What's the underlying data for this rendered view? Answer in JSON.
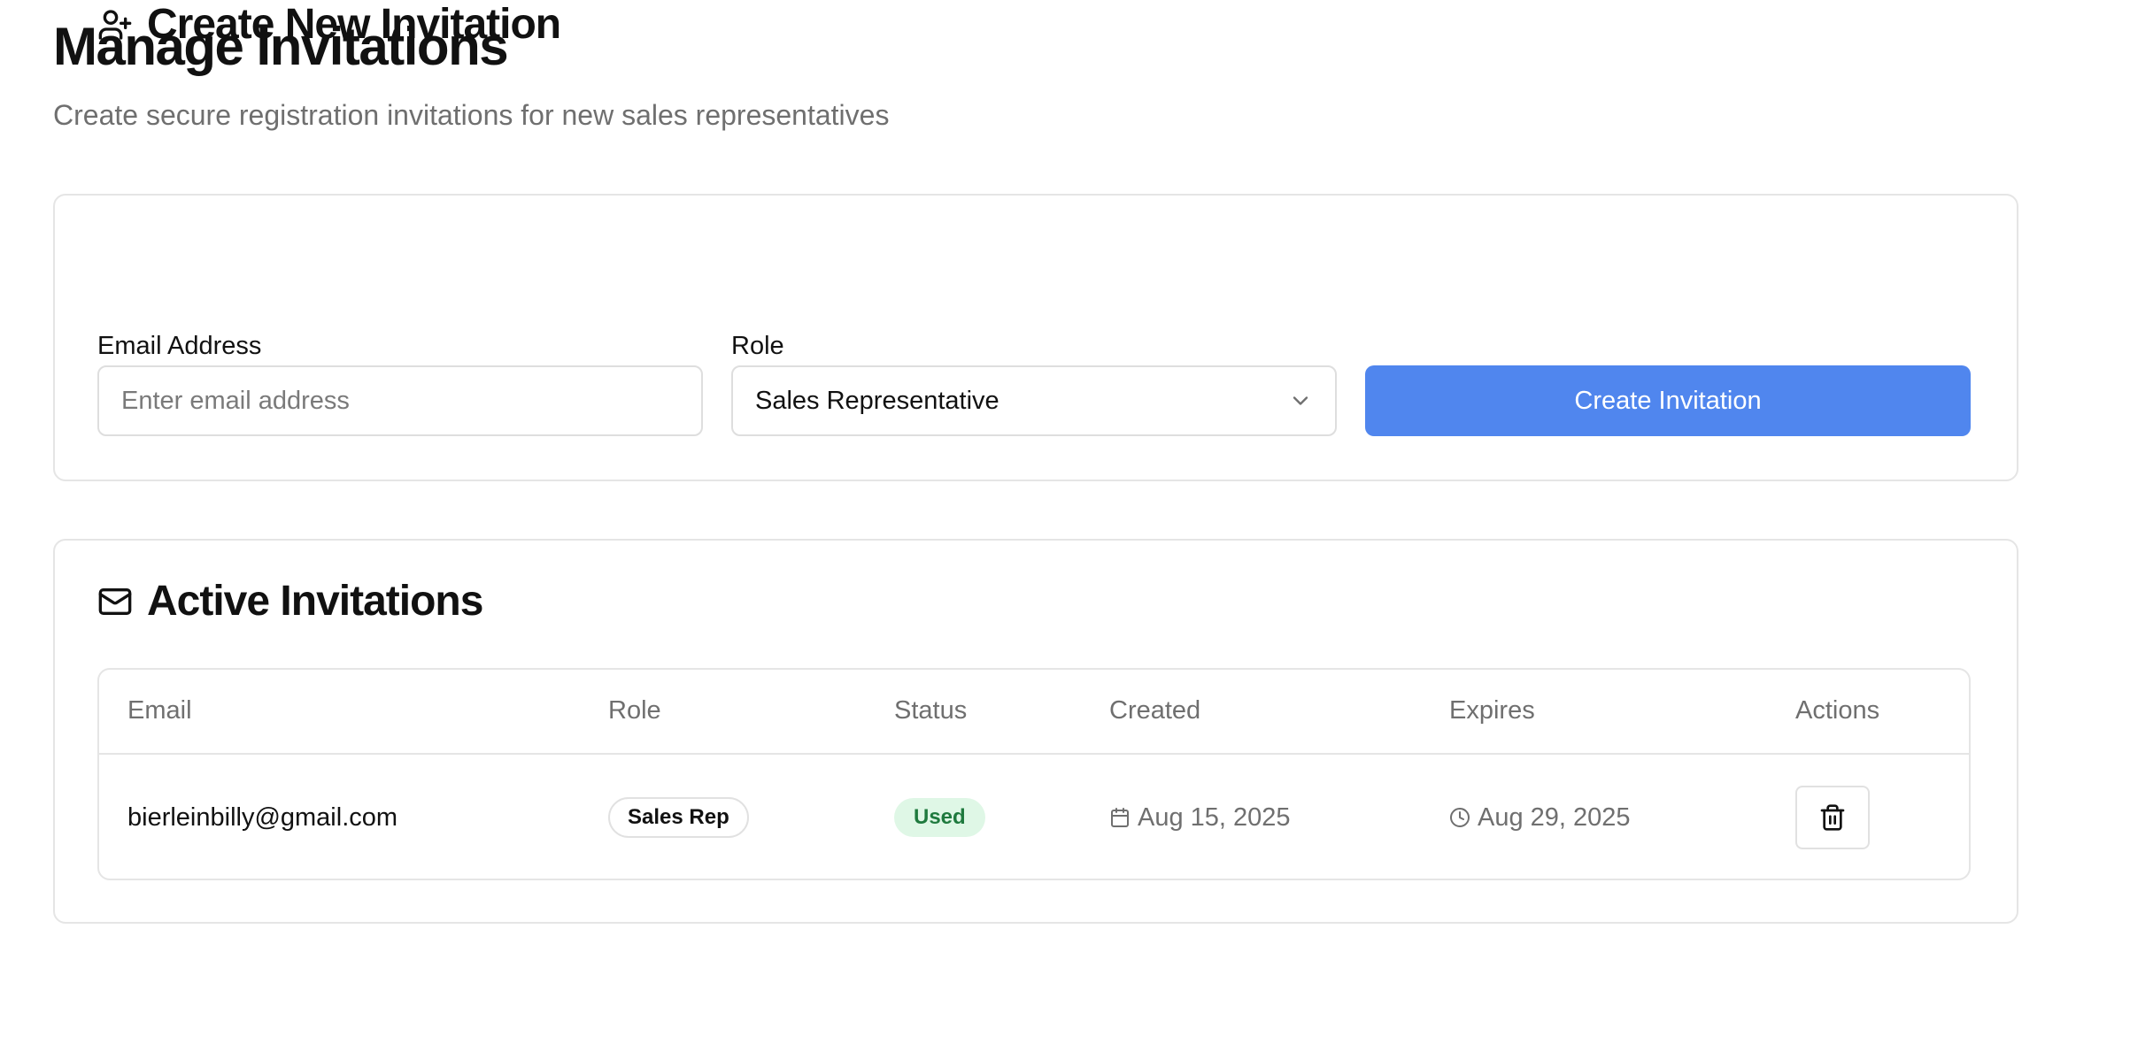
{
  "page": {
    "title": "Manage Invitations",
    "subtitle": "Create secure registration invitations for new sales representatives"
  },
  "create_card": {
    "icon": "user-plus-icon",
    "title": "Create New Invitation",
    "email_label": "Email Address",
    "email_placeholder": "Enter email address",
    "email_value": "",
    "role_label": "Role",
    "role_selected": "Sales Representative",
    "button_label": "Create Invitation"
  },
  "active_card": {
    "icon": "mail-icon",
    "title": "Active Invitations",
    "columns": [
      "Email",
      "Role",
      "Status",
      "Created",
      "Expires",
      "Actions"
    ],
    "rows": [
      {
        "email": "bierleinbilly@gmail.com",
        "role": "Sales Rep",
        "status": "Used",
        "created": "Aug 15, 2025",
        "expires": "Aug 29, 2025",
        "action_icon": "trash-icon"
      }
    ]
  },
  "colors": {
    "accent": "#5086ee",
    "status_used_bg": "#dff7e6",
    "status_used_text": "#1f7a3e",
    "muted_text": "#6f6f6f",
    "border": "#e5e5e5"
  }
}
